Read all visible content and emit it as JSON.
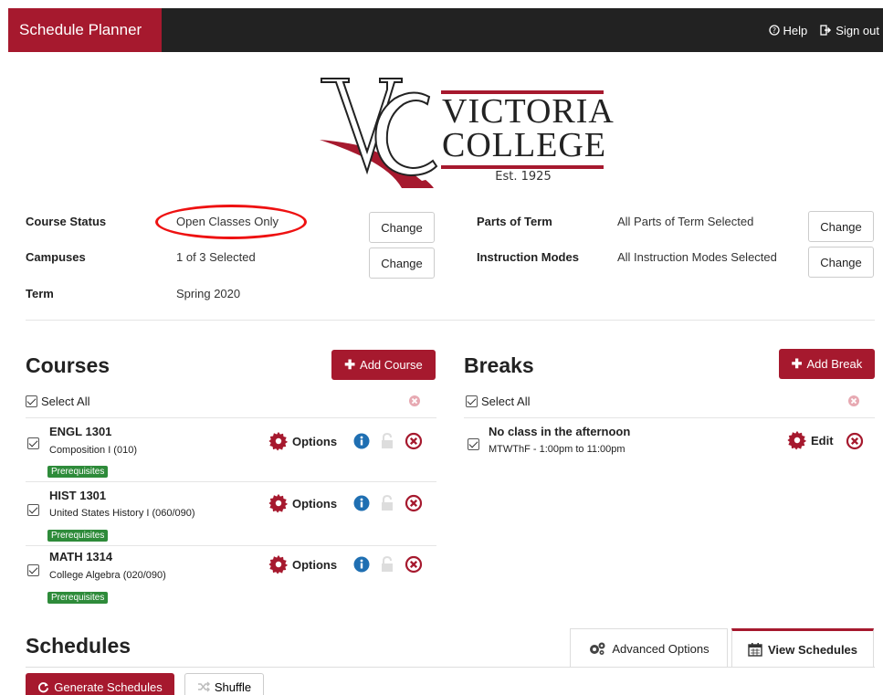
{
  "header": {
    "brand": "Schedule Planner",
    "help_label": "Help",
    "signout_label": "Sign out"
  },
  "logo": {
    "line1": "VICTORIA",
    "line2": "COLLEGE",
    "est": "Est. 1925",
    "letters": "VC"
  },
  "settings": {
    "course_status_label": "Course Status",
    "course_status_value": "Open Classes Only",
    "campuses_label": "Campuses",
    "campuses_value": "1 of 3 Selected",
    "term_label": "Term",
    "term_value": "Spring 2020",
    "parts_of_term_label": "Parts of Term",
    "parts_of_term_value": "All Parts of Term Selected",
    "instruction_modes_label": "Instruction Modes",
    "instruction_modes_value": "All Instruction Modes Selected",
    "change_label": "Change"
  },
  "courses": {
    "title": "Courses",
    "add_label": "Add Course",
    "select_all_label": "Select All",
    "options_label": "Options",
    "prereq_label": "Prerequisites",
    "items": [
      {
        "code": "ENGL 1301",
        "name": "Composition I (010)"
      },
      {
        "code": "HIST 1301",
        "name": "United States History I (060/090)"
      },
      {
        "code": "MATH 1314",
        "name": "College Algebra (020/090)"
      }
    ]
  },
  "breaks": {
    "title": "Breaks",
    "add_label": "Add Break",
    "select_all_label": "Select All",
    "edit_label": "Edit",
    "items": [
      {
        "title": "No class in the afternoon",
        "detail": "MTWThF - 1:00pm to 11:00pm"
      }
    ]
  },
  "schedules": {
    "title": "Schedules",
    "tab_advanced": "Advanced Options",
    "tab_view": "View Schedules",
    "generate_label": "Generate Schedules",
    "shuffle_label": "Shuffle"
  },
  "colors": {
    "brand": "#a6192e",
    "topbar": "#222222",
    "prereq": "#2e8b3a",
    "info": "#1f6fb2",
    "annotation": "#e11111"
  }
}
